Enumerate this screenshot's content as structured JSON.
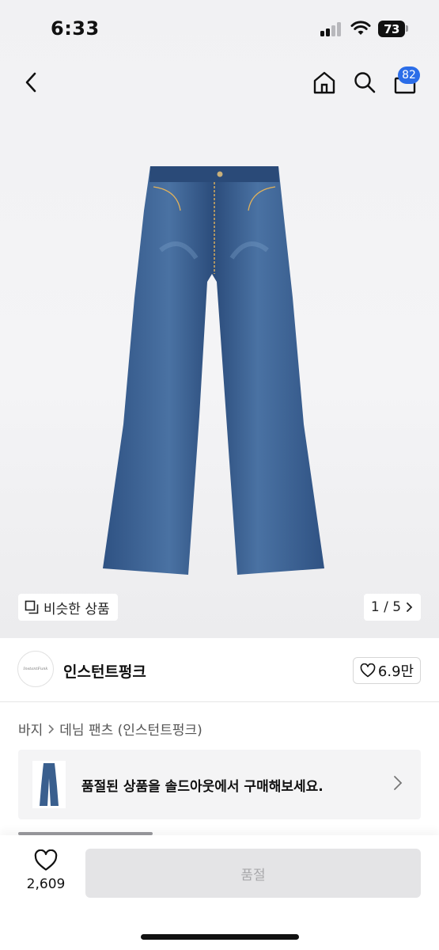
{
  "status_bar": {
    "time": "6:33",
    "battery": "73"
  },
  "header": {
    "cart_count": "82"
  },
  "gallery": {
    "similar_label": "비슷한 상품",
    "counter": "1 / 5"
  },
  "shop": {
    "name": "인스턴트펑크",
    "logo_text": "InstantFunk",
    "likes": "6.9만"
  },
  "breadcrumb": {
    "level1": "바지",
    "level2": "데님 팬츠 (인스턴트펑크)"
  },
  "soldout_banner": {
    "text": "품절된 상품을 솔드아웃에서 구매해보세요."
  },
  "bottom_bar": {
    "wish_count": "2,609",
    "button_label": "품절"
  },
  "colors": {
    "accent": "#2b6de8",
    "denim": "#3a5f8e",
    "disabled_bg": "#e4e4e6",
    "disabled_text": "#a8a8ab"
  }
}
